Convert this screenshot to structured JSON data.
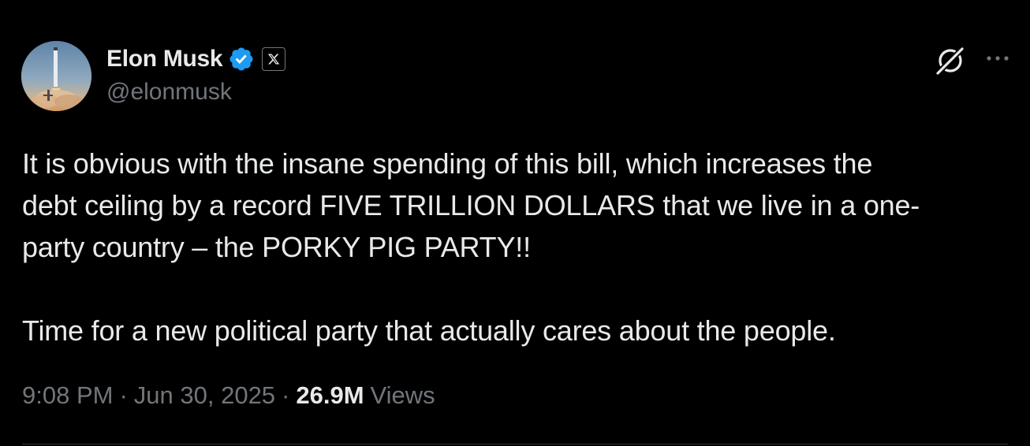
{
  "author": {
    "display_name": "Elon Musk",
    "handle": "@elonmusk",
    "verified": true,
    "verified_color": "#1d9bf0",
    "affiliate_badge_icon": "x-logo-icon",
    "avatar_icon": "rocket-launch-avatar"
  },
  "header_actions": {
    "grok_icon": "grok-icon",
    "more_icon": "more-horizontal-icon"
  },
  "tweet": {
    "lines": [
      "It is obvious with the insane spending of this bill, which increases the",
      "debt ceiling by a record FIVE TRILLION DOLLARS that we live in a one-",
      "party country – the PORKY PIG PARTY!!"
    ],
    "paragraph2": "Time for a new political party that actually cares about the people."
  },
  "meta": {
    "time": "9:08 PM",
    "separator": "·",
    "date": "Jun 30, 2025",
    "views_count": "26.9M",
    "views_label": "Views"
  },
  "colors": {
    "background": "#000000",
    "primary_text": "#e7e9ea",
    "secondary_text": "#71767b",
    "divider": "#2f3336"
  }
}
